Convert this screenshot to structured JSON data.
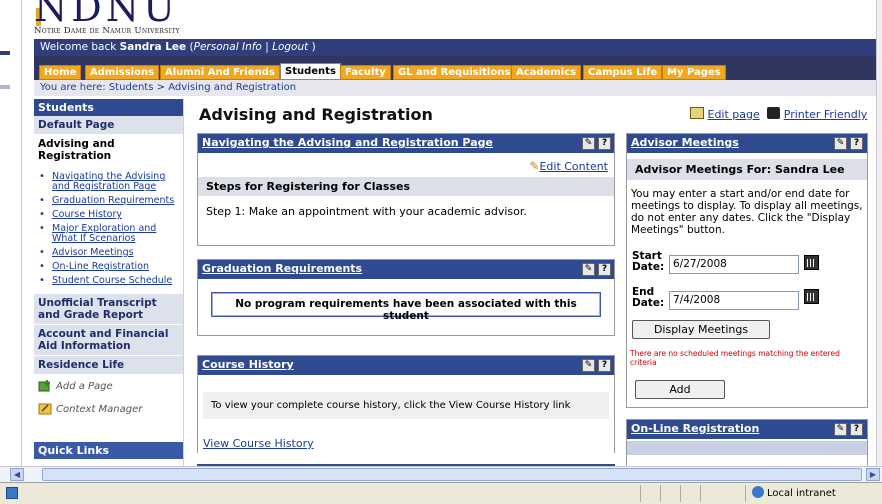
{
  "header": {
    "logo_text": "NDNU",
    "logo_subtitle": "Notre Dame de Namur University",
    "welcome_prefix": "Welcome back",
    "user_name": "Sandra Lee",
    "welcome_open": "(",
    "personal_info_link": "Personal Info",
    "separator": "|",
    "logout_link": "Logout",
    "welcome_close": ")"
  },
  "nav": {
    "tabs": [
      {
        "label": "Home"
      },
      {
        "label": "Admissions"
      },
      {
        "label": "Alumni And Friends"
      },
      {
        "label": "Students"
      },
      {
        "label": "Faculty"
      },
      {
        "label": "GL and Requisitions"
      },
      {
        "label": "Academics"
      },
      {
        "label": "Campus Life"
      },
      {
        "label": "My Pages"
      }
    ]
  },
  "breadcrumb": {
    "prefix": "You are here:",
    "item1": "Students",
    "sep": ">",
    "item2": "Advising and Registration"
  },
  "sidebar": {
    "heading": "Students",
    "sections": {
      "default_page": "Default Page",
      "advising": "Advising and Registration",
      "transcript": "Unofficial Transcript and Grade Report",
      "account": "Account and Financial Aid Information",
      "residence": "Residence Life",
      "quick_links": "Quick Links"
    },
    "items": [
      "Navigating the Advising and Registration Page",
      "Graduation Requirements",
      "Course History",
      "Major Exploration and What If Scenarios",
      "Advisor Meetings",
      "On-Line Registration",
      "Student Course Schedule"
    ],
    "tools": {
      "add_page": "Add a Page",
      "context_manager": "Context Manager"
    }
  },
  "main": {
    "title": "Advising and Registration",
    "edit_page": "Edit page",
    "printer_friendly": "Printer Friendly",
    "nav_panel": {
      "title": "Navigating the Advising and Registration Page",
      "edit_content": "Edit Content",
      "steps_heading": "Steps for Registering for Classes",
      "step1": "Step 1:  Make an appointment with your academic advisor."
    },
    "grad_panel": {
      "title": "Graduation Requirements",
      "message": "No program requirements have been associated with this student"
    },
    "course_panel": {
      "title": "Course History",
      "message": "To view your complete course history, click the View Course History link",
      "link": "View Course History"
    }
  },
  "advisor": {
    "title": "Advisor Meetings",
    "for_label": "Advisor Meetings For: Sandra Lee",
    "instructions": "You may enter a start and/or end date for meetings to display. To display all meetings, do not enter any dates. Click the \"Display Meetings\" button.",
    "start_label": "Start Date:",
    "start_value": "6/27/2008",
    "end_label": "End Date:",
    "end_value": "7/4/2008",
    "display_button": "Display Meetings",
    "no_meetings": "There are no scheduled meetings matching the entered criteria",
    "add_button": "Add"
  },
  "online_reg": {
    "title": "On-Line Registration"
  },
  "panel_icons": {
    "edit": "edit-icon",
    "help": "?"
  },
  "status": {
    "zone": "Local intranet"
  },
  "colors": {
    "nav_dark": "#31365f",
    "panel_head": "#2f4a8e",
    "tab_orange": "#f2a81d",
    "error_red": "#cc0000"
  }
}
